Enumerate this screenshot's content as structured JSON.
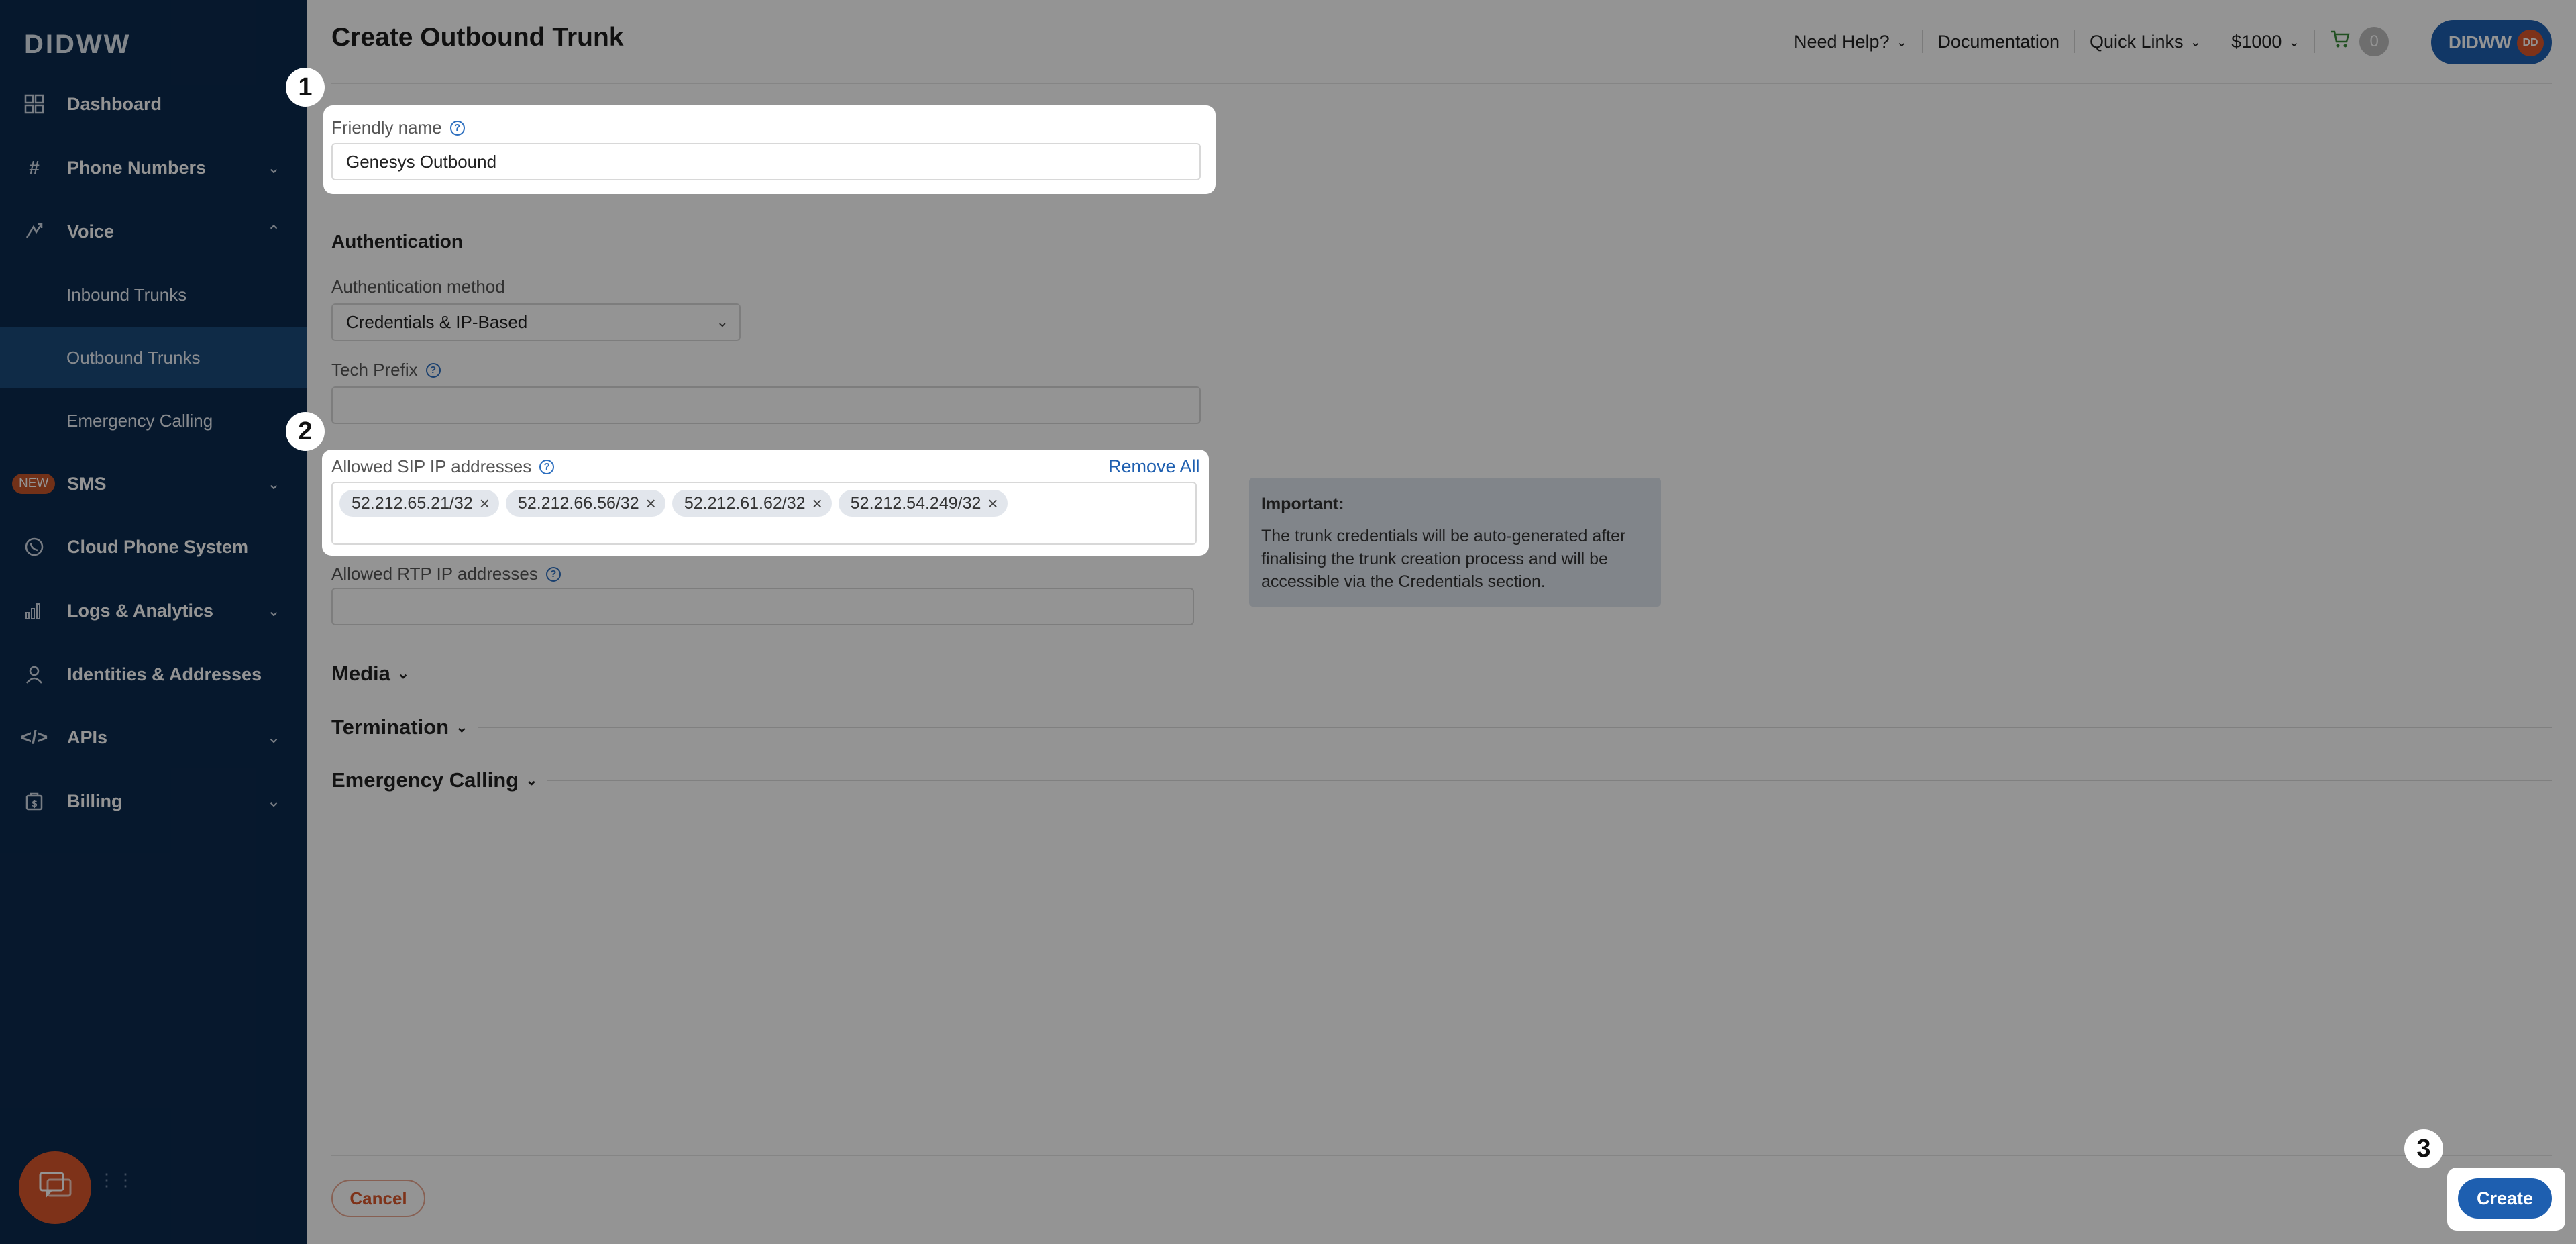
{
  "sidebar": {
    "logo": "DIDWW",
    "items": [
      {
        "label": "Dashboard",
        "icon": "grid-icon"
      },
      {
        "label": "Phone Numbers",
        "icon": "hash-icon"
      },
      {
        "label": "Voice",
        "icon": "call-arrows-icon"
      },
      {
        "label": "Inbound Trunks"
      },
      {
        "label": "Outbound Trunks"
      },
      {
        "label": "Emergency Calling"
      },
      {
        "label": "SMS",
        "badge": "NEW"
      },
      {
        "label": "Cloud Phone System",
        "icon": "phone-circle-icon"
      },
      {
        "label": "Logs & Analytics",
        "icon": "bar-chart-icon"
      },
      {
        "label": "Identities & Addresses",
        "icon": "user-icon"
      },
      {
        "label": "APIs",
        "icon": "code-icon"
      },
      {
        "label": "Billing",
        "icon": "billing-icon"
      }
    ]
  },
  "header": {
    "title": "Create Outbound Trunk",
    "need_help": "Need Help?",
    "documentation": "Documentation",
    "quick_links": "Quick Links",
    "balance": "$1000",
    "cart_count": "0",
    "account": "DIDWW",
    "avatar": "DD"
  },
  "form": {
    "friendly_name_label": "Friendly name",
    "friendly_name_value": "Genesys Outbound",
    "authentication_heading": "Authentication",
    "auth_method_label": "Authentication method",
    "auth_method_value": "Credentials & IP-Based",
    "tech_prefix_label": "Tech Prefix",
    "tech_prefix_value": "",
    "allowed_sip_label": "Allowed SIP IP addresses",
    "remove_all": "Remove All",
    "sip_ips": [
      "52.212.65.21/32",
      "52.212.66.56/32",
      "52.212.61.62/32",
      "52.212.54.249/32"
    ],
    "allowed_rtp_label": "Allowed RTP IP addresses",
    "allowed_rtp_value": ""
  },
  "info": {
    "title": "Important:",
    "text": "The trunk credentials will be auto-generated after finalising the trunk creation process and will be accessible via the Credentials section."
  },
  "sections": {
    "media": "Media",
    "termination": "Termination",
    "emergency_calling": "Emergency Calling"
  },
  "footer": {
    "cancel": "Cancel",
    "create": "Create"
  },
  "steps": [
    "1",
    "2",
    "3"
  ],
  "colors": {
    "sidebar_bg": "#0c2a4e",
    "sidebar_active": "#1b4a7a",
    "accent_blue": "#1e5fb0",
    "accent_orange": "#d9572b"
  }
}
